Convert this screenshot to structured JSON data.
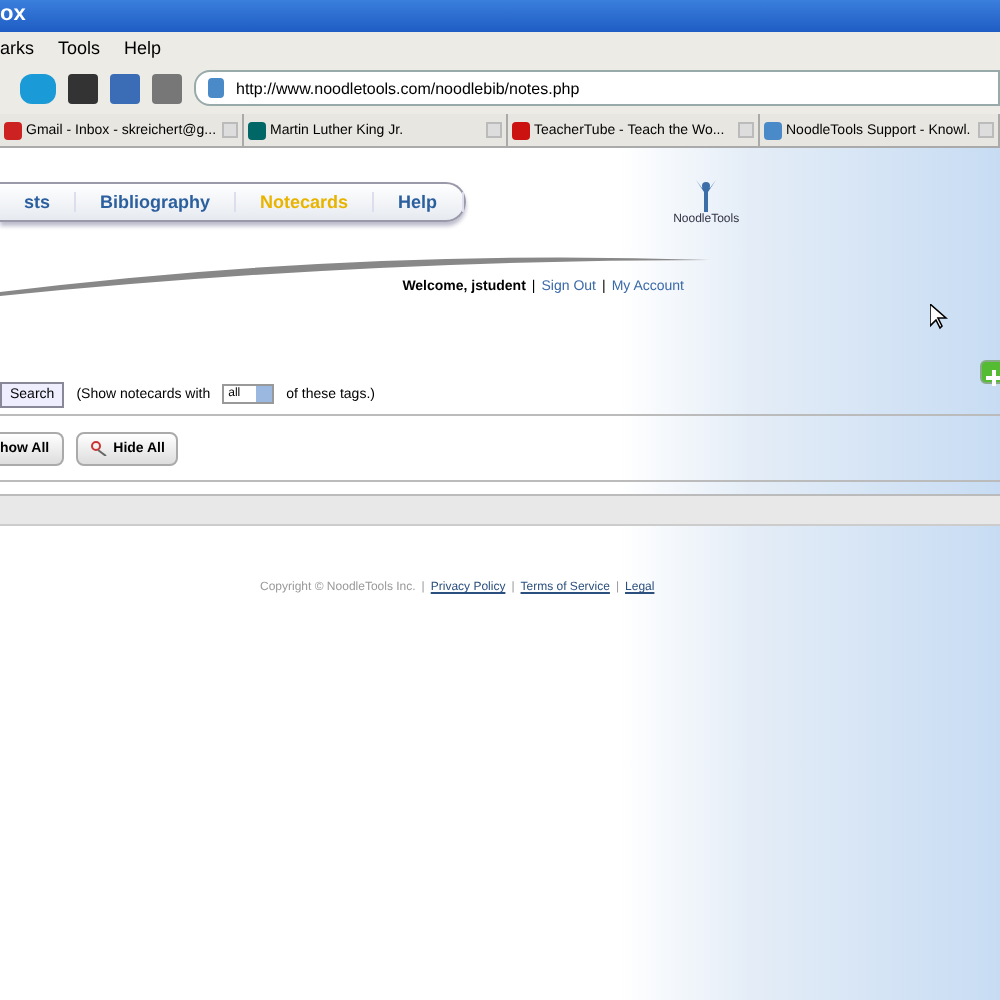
{
  "window": {
    "title": "ox"
  },
  "menu": [
    "arks",
    "Tools",
    "Help"
  ],
  "address": {
    "value": "http://www.noodletools.com/noodlebib/notes.php"
  },
  "tabs": [
    {
      "label": "Gmail - Inbox - skreichert@g...",
      "selected": false
    },
    {
      "label": "Martin Luther King Jr.",
      "selected": false
    },
    {
      "label": "TeacherTube - Teach the Wo...",
      "selected": false
    },
    {
      "label": "NoodleTools Support - Knowl.",
      "selected": false
    }
  ],
  "nav": [
    {
      "label": "sts",
      "selected": false
    },
    {
      "label": "Bibliography",
      "selected": false
    },
    {
      "label": "Notecards",
      "selected": true
    },
    {
      "label": "Help",
      "selected": false
    }
  ],
  "logo": {
    "text": "NoodleTools"
  },
  "user_bar": {
    "welcome": "Welcome, jstudent",
    "separator": "|",
    "links": [
      "Sign Out",
      "My Account"
    ]
  },
  "search": {
    "button": "Search",
    "before": "(Show notecards with",
    "select": "all",
    "after": "of these tags.)"
  },
  "actions": [
    "how All",
    "Hide All"
  ],
  "footer": {
    "copyright": "Copyright © NoodleTools Inc.",
    "separator": "|",
    "links": [
      "Privacy Policy",
      "Terms of Service",
      "Legal"
    ]
  }
}
